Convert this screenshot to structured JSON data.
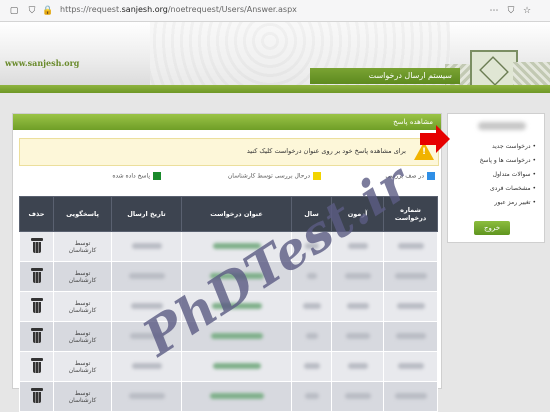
{
  "browser": {
    "url_prefix": "https://request.",
    "url_domain": "sanjesh.org",
    "url_path": "/noetrequest/Users/Answer.aspx"
  },
  "header": {
    "site_url": "www.sanjesh.org",
    "title": "سیستم ارسال درخواست"
  },
  "panel": {
    "title": "مشاهده پاسخ",
    "notice": "برای مشاهده پاسخ خود بر روی عنوان درخواست کلیک کنید",
    "legend": [
      {
        "label": "پاسخ داده شده",
        "color": "#1a8a2b"
      },
      {
        "label": "درحال بررسی توسط کارشناسان",
        "color": "#f2d400"
      },
      {
        "label": "در صف بررسی",
        "color": "#2f8fe6"
      }
    ]
  },
  "table": {
    "headers": [
      "شماره درخواست",
      "آزمون",
      "سال",
      "عنوان درخواست",
      "تاریخ ارسال",
      "پاسخگویی",
      "حذف"
    ],
    "responder_line1": "توسط",
    "responder_line2": "کارشناسان",
    "row_count": 6
  },
  "sidebar": {
    "items": [
      "درخواست جدید",
      "درخواست ها و پاسخ",
      "سوالات متداول",
      "مشخصات فردی",
      "تغییر رمز عبور"
    ],
    "logout": "خروج"
  },
  "watermark": "PhDTest.ir",
  "colors": {
    "accent": "#6f9e27",
    "table_header": "#3d4450",
    "arrow": "#e60000"
  }
}
